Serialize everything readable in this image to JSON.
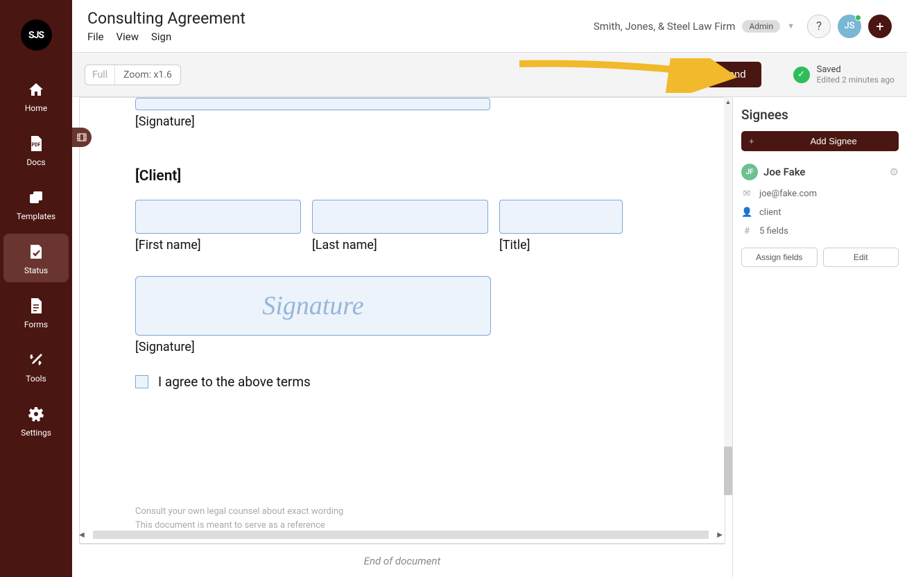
{
  "sidebar": {
    "logo": "SJS",
    "items": [
      {
        "label": "Home"
      },
      {
        "label": "Docs"
      },
      {
        "label": "Templates"
      },
      {
        "label": "Status"
      },
      {
        "label": "Forms"
      },
      {
        "label": "Tools"
      },
      {
        "label": "Settings"
      }
    ]
  },
  "header": {
    "title": "Consulting Agreement",
    "menu": {
      "file": "File",
      "view": "View",
      "sign": "Sign"
    },
    "firm": "Smith, Jones, & Steel Law Firm",
    "admin": "Admin",
    "help": "?",
    "avatar": "JS",
    "plus": "+"
  },
  "toolbar": {
    "full": "Full",
    "zoom": "Zoom: x1.6",
    "send": "Send",
    "status_title": "Saved",
    "status_sub": "Edited 2 minutes ago"
  },
  "document": {
    "sig_label_1": "[Signature]",
    "client_heading": "[Client]",
    "first_name": "[First name]",
    "last_name": "[Last name]",
    "title_field": "[Title]",
    "signature_ph": "Signature",
    "sig_label_2": "[Signature]",
    "agree": "I agree to the above terms",
    "footer1": "Consult your own legal counsel about exact wording",
    "footer2": "This document is meant to serve as a reference",
    "end": "End of document"
  },
  "panel": {
    "title": "Signees",
    "add": "Add Signee",
    "signee": {
      "initials": "JF",
      "name": "Joe Fake",
      "email": "joe@fake.com",
      "role": "client",
      "fields": "5 fields"
    },
    "assign": "Assign fields",
    "edit": "Edit"
  }
}
